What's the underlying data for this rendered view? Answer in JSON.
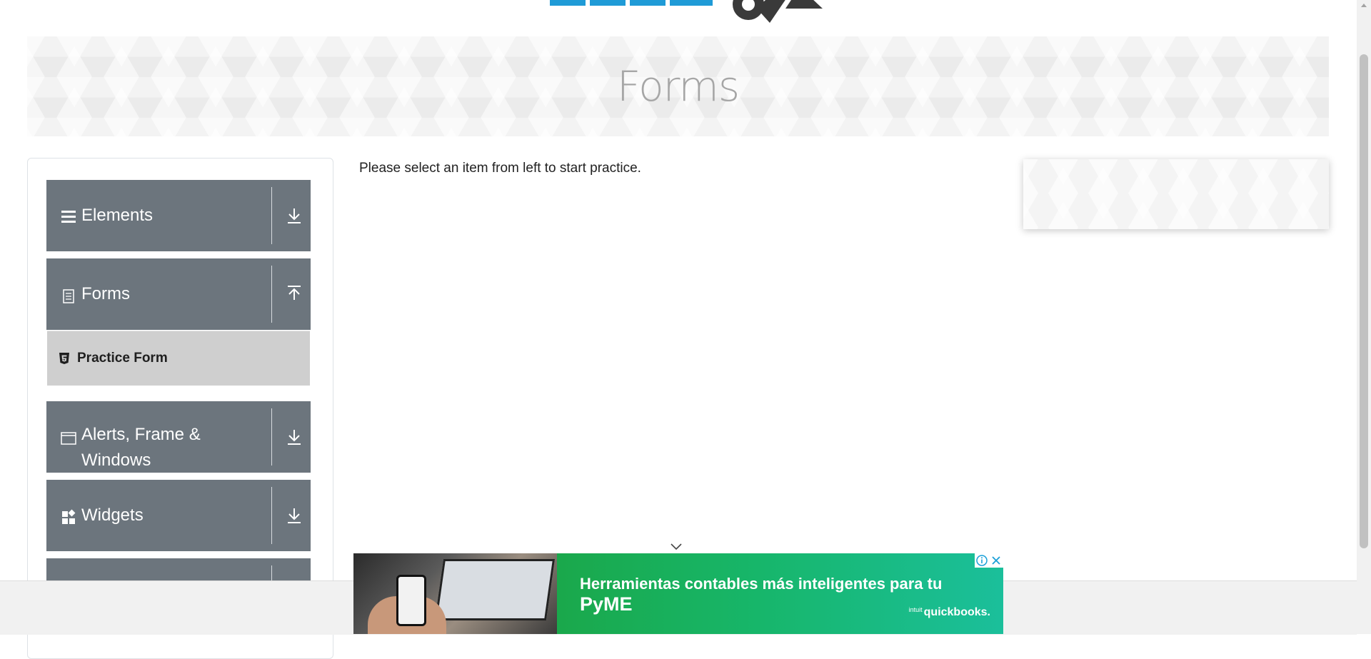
{
  "banner": {
    "title": "Forms"
  },
  "sidebar": {
    "groups": [
      {
        "label": "Elements",
        "icon": "hamburger-icon",
        "arrow": "download-arrow-icon"
      },
      {
        "label": "Forms",
        "icon": "document-icon",
        "arrow": "upload-arrow-icon"
      },
      {
        "label": "Alerts, Frame & Windows",
        "label_line1": "Alerts, Frame &",
        "label_line2": "Windows",
        "icon": "window-icon",
        "arrow": "download-arrow-icon"
      },
      {
        "label": "Widgets",
        "icon": "widgets-icon",
        "arrow": "download-arrow-icon"
      }
    ],
    "forms_items": [
      {
        "label": "Practice Form",
        "icon": "html5-icon"
      }
    ]
  },
  "main": {
    "message": "Please select an item from left to start practice."
  },
  "ad": {
    "headline_line1": "Herramientas contables más inteligentes para tu",
    "headline_line2": "PyME",
    "brand": "quickbooks.",
    "brand_prefix": "intuit",
    "colors": {
      "green_start": "#1aa84b",
      "green_end": "#1bbf9b"
    }
  },
  "colors": {
    "menu_bg": "#6c757d",
    "submenu_bg": "#cfcfcf",
    "banner_text": "#a6a6a6"
  }
}
